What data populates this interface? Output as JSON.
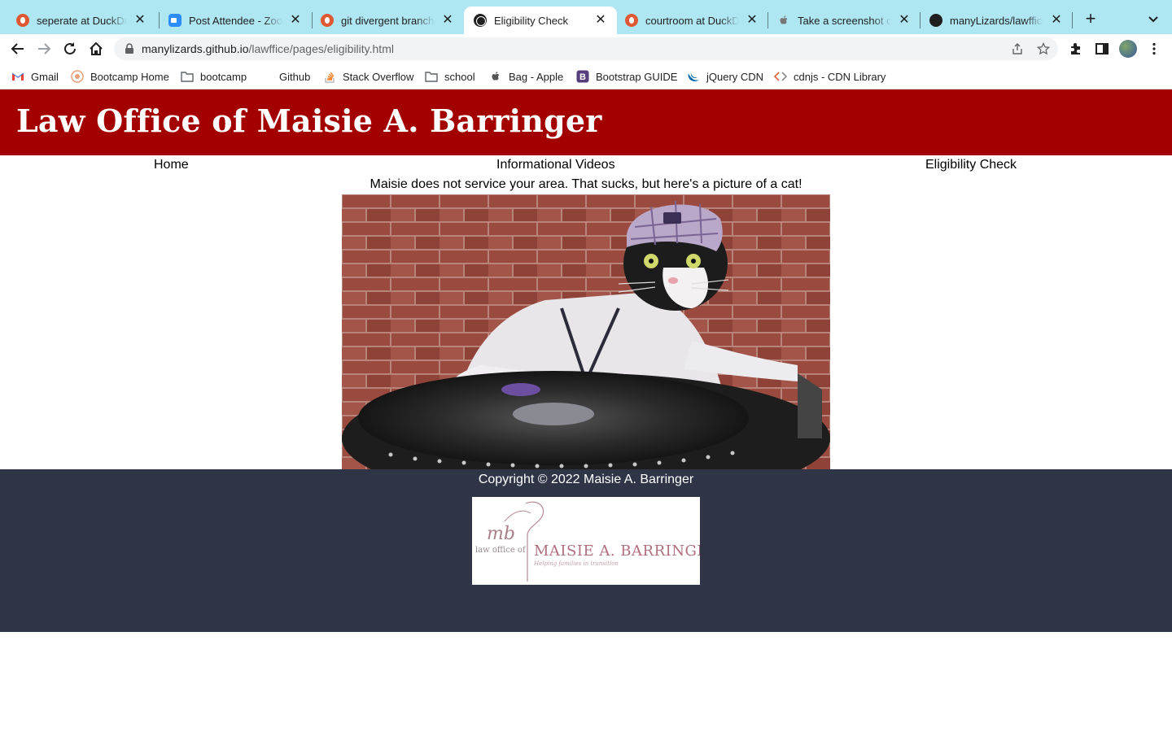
{
  "browser": {
    "tabs": [
      {
        "title": "seperate at DuckDuckGo",
        "icon": "duckduckgo-icon",
        "active": false
      },
      {
        "title": "Post Attendee - Zoom",
        "icon": "zoom-icon",
        "active": false
      },
      {
        "title": "git divergent branches",
        "icon": "duckduckgo-icon",
        "active": false
      },
      {
        "title": "Eligibility Check",
        "icon": "globe-icon",
        "active": true
      },
      {
        "title": "courtroom at DuckDuckGo",
        "icon": "duckduckgo-icon",
        "active": false
      },
      {
        "title": "Take a screenshot on",
        "icon": "apple-icon",
        "active": false
      },
      {
        "title": "manyLizards/lawffice",
        "icon": "github-icon",
        "active": false
      }
    ],
    "url_host": "manylizards.github.io",
    "url_path": "/lawffice/pages/eligibility.html",
    "bookmarks": [
      {
        "label": "Gmail",
        "icon": "gmail-icon"
      },
      {
        "label": "Bootcamp Home",
        "icon": "bootcamp-icon"
      },
      {
        "label": "bootcamp",
        "icon": "folder-icon"
      },
      {
        "label": "Github",
        "icon": "github-icon"
      },
      {
        "label": "Stack Overflow",
        "icon": "stackoverflow-icon"
      },
      {
        "label": "school",
        "icon": "folder-icon"
      },
      {
        "label": "Bag - Apple",
        "icon": "apple-icon"
      },
      {
        "label": "Bootstrap GUIDE",
        "icon": "bootstrap-icon"
      },
      {
        "label": "jQuery CDN",
        "icon": "jquery-icon"
      },
      {
        "label": "cdnjs - CDN Library",
        "icon": "cdnjs-icon"
      }
    ]
  },
  "site": {
    "title": "Law Office of Maisie A. Barringer",
    "nav": {
      "home": "Home",
      "videos": "Informational Videos",
      "eligibility": "Eligibility Check"
    },
    "message": "Maisie does not service your area. That sucks, but here's a picture of a cat!",
    "footer": {
      "copyright": "Copyright © 2022 Maisie A. Barringer",
      "logo": {
        "monogram": "mb",
        "prefix": "law office of",
        "name": "MAISIE A. BARRINGER",
        "tagline": "Helping families in transition"
      }
    }
  },
  "colors": {
    "tab_bar": "#aee6f2",
    "header": "#a30000",
    "footer": "#2f3447"
  }
}
